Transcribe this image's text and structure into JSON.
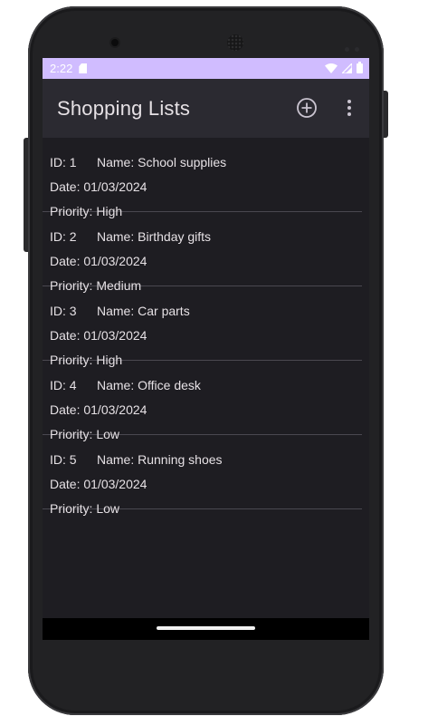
{
  "status": {
    "time": "2:22"
  },
  "appbar": {
    "title": "Shopping Lists"
  },
  "labels": {
    "date_prefix": "Date: ",
    "priority_prefix": "Priority: "
  },
  "lists": [
    {
      "id": "ID: 1",
      "name": "Name: School supplies",
      "date": "01/03/2024",
      "priority": "High"
    },
    {
      "id": "ID: 2",
      "name": "Name: Birthday gifts",
      "date": "01/03/2024",
      "priority": "Medium"
    },
    {
      "id": "ID: 3",
      "name": "Name: Car parts",
      "date": "01/03/2024",
      "priority": "High"
    },
    {
      "id": "ID: 4",
      "name": "Name: Office desk",
      "date": "01/03/2024",
      "priority": "Low"
    },
    {
      "id": "ID: 5",
      "name": "Name: Running shoes",
      "date": "01/03/2024",
      "priority": "Low"
    }
  ],
  "colors": {
    "accent": "#d0bcff",
    "background": "#1e1d22",
    "appbar": "#2b2a31"
  },
  "icons": {
    "add": "add-circle-icon",
    "more": "more-vert-icon"
  }
}
